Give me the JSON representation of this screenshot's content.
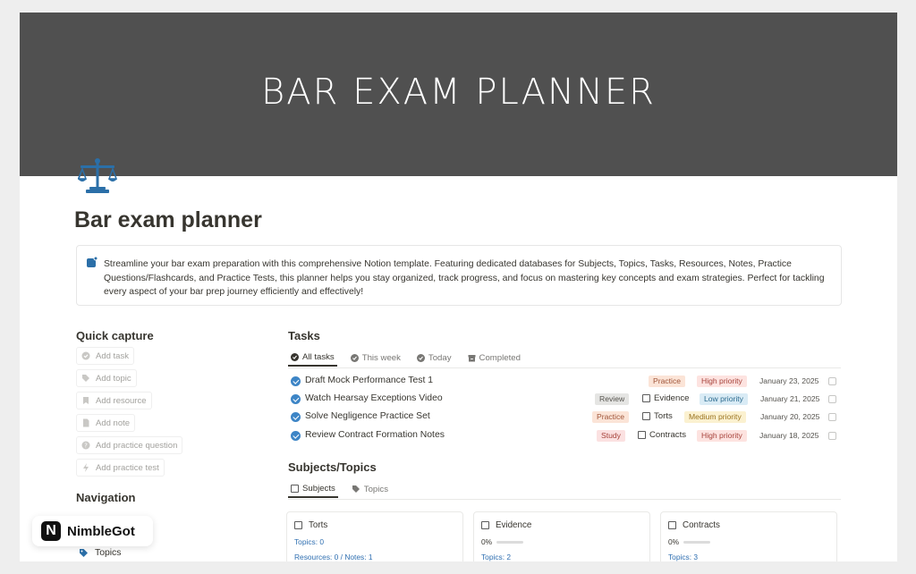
{
  "cover": {
    "title": "BAR EXAM PLANNER"
  },
  "page": {
    "title": "Bar exam planner"
  },
  "callout": {
    "text": "Streamline your bar exam preparation with this comprehensive Notion template. Featuring dedicated databases for Subjects, Topics, Tasks, Resources, Notes, Practice Questions/Flashcards, and Practice Tests, this planner helps you stay organized, track progress, and focus on mastering key concepts and exam strategies. Perfect for tackling every aspect of your bar prep journey efficiently and effectively!"
  },
  "quick_capture": {
    "heading": "Quick capture",
    "items": [
      {
        "label": "Add task",
        "icon": "check-circle-icon"
      },
      {
        "label": "Add topic",
        "icon": "tag-icon"
      },
      {
        "label": "Add resource",
        "icon": "bookmark-icon"
      },
      {
        "label": "Add note",
        "icon": "document-icon"
      },
      {
        "label": "Add practice question",
        "icon": "question-icon"
      },
      {
        "label": "Add practice test",
        "icon": "bolt-icon"
      }
    ]
  },
  "navigation": {
    "heading": "Navigation",
    "items": [
      {
        "label": "Topics",
        "icon": "tag-icon"
      }
    ]
  },
  "tasks": {
    "heading": "Tasks",
    "tabs": [
      {
        "label": "All tasks",
        "active": true
      },
      {
        "label": "This week",
        "active": false
      },
      {
        "label": "Today",
        "active": false
      },
      {
        "label": "Completed",
        "active": false
      }
    ],
    "rows": [
      {
        "name": "Draft Mock Performance Test 1",
        "type": "Practice",
        "subject": "",
        "priority": "High priority",
        "date": "January 23, 2025"
      },
      {
        "name": "Watch Hearsay Exceptions Video",
        "type": "Review",
        "subject": "Evidence",
        "priority": "Low priority",
        "date": "January 21, 2025"
      },
      {
        "name": "Solve Negligence Practice Set",
        "type": "Practice",
        "subject": "Torts",
        "priority": "Medium priority",
        "date": "January 20, 2025"
      },
      {
        "name": "Review Contract Formation Notes",
        "type": "Study",
        "subject": "Contracts",
        "priority": "High priority",
        "date": "January 18, 2025"
      }
    ]
  },
  "subjects": {
    "heading": "Subjects/Topics",
    "tabs": [
      {
        "label": "Subjects",
        "active": true
      },
      {
        "label": "Topics",
        "active": false
      }
    ],
    "cards": [
      {
        "name": "Torts",
        "line1": "Topics: 0",
        "line2": "Resources: 0 / Notes: 1"
      },
      {
        "name": "Evidence",
        "progress": "0%",
        "line2": "Topics: 2"
      },
      {
        "name": "Contracts",
        "progress": "0%",
        "line2": "Topics: 3"
      }
    ]
  },
  "watermark": {
    "logo": "N",
    "text": "NimbleGot"
  },
  "colors": {
    "cover": "#505050",
    "accent": "#3d85c6"
  }
}
